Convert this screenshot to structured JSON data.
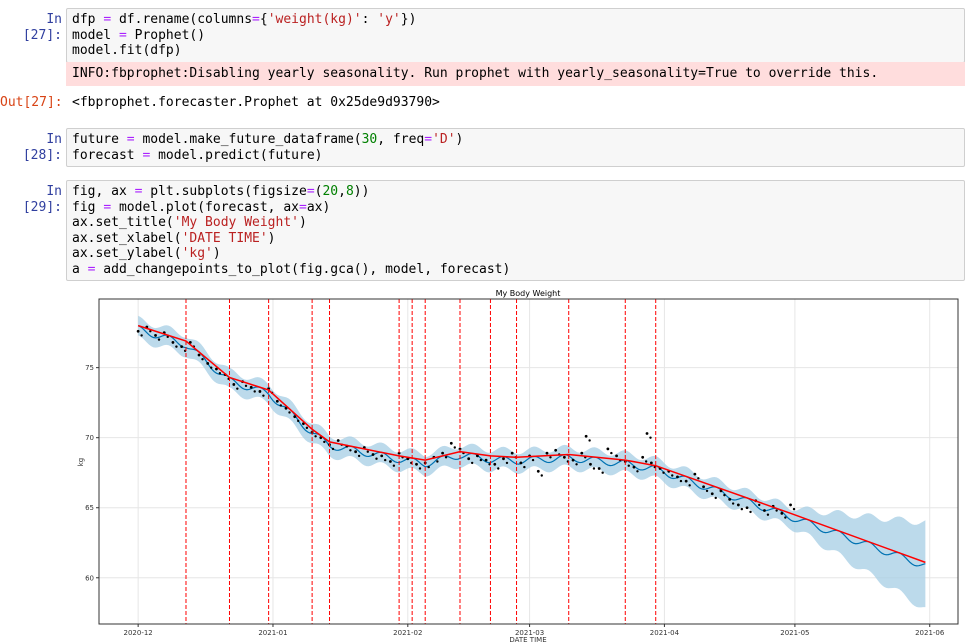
{
  "cells": [
    {
      "prompt": "In [27]:",
      "lines": [
        [
          [
            "dfp ",
            ""
          ],
          [
            "=",
            "op"
          ],
          [
            " df.rename(columns",
            ""
          ],
          [
            "=",
            "op"
          ],
          [
            "{",
            ""
          ],
          [
            "'weight(kg)'",
            "str"
          ],
          [
            ": ",
            ""
          ],
          [
            "'y'",
            "str"
          ],
          [
            "})",
            ""
          ]
        ],
        [
          [
            "model ",
            ""
          ],
          [
            "=",
            "op"
          ],
          [
            " Prophet()",
            ""
          ]
        ],
        [
          [
            "model.fit(dfp)",
            ""
          ]
        ]
      ]
    },
    {
      "prompt": "In [28]:",
      "lines": [
        [
          [
            "future ",
            ""
          ],
          [
            "=",
            "op"
          ],
          [
            " model.make_future_dataframe(",
            ""
          ],
          [
            "30",
            "num"
          ],
          [
            ", freq",
            ""
          ],
          [
            "=",
            "op"
          ],
          [
            "'D'",
            "str"
          ],
          [
            ")",
            ""
          ]
        ],
        [
          [
            "forecast ",
            ""
          ],
          [
            "=",
            "op"
          ],
          [
            " model.predict(future)",
            ""
          ]
        ]
      ]
    },
    {
      "prompt": "In [29]:",
      "lines": [
        [
          [
            "fig, ax ",
            ""
          ],
          [
            "=",
            "op"
          ],
          [
            " plt.subplots(figsize",
            ""
          ],
          [
            "=",
            "op"
          ],
          [
            "(",
            ""
          ],
          [
            "20",
            "num"
          ],
          [
            ",",
            ""
          ],
          [
            "8",
            "num"
          ],
          [
            "))",
            ""
          ]
        ],
        [
          [
            "fig ",
            ""
          ],
          [
            "=",
            "op"
          ],
          [
            " model.plot(forecast, ax",
            ""
          ],
          [
            "=",
            "op"
          ],
          [
            "ax)",
            ""
          ]
        ],
        [
          [
            "ax.set_title(",
            ""
          ],
          [
            "'My Body Weight'",
            "str"
          ],
          [
            ")",
            ""
          ]
        ],
        [
          [
            "ax.set_xlabel(",
            ""
          ],
          [
            "'DATE TIME'",
            "str"
          ],
          [
            ")",
            ""
          ]
        ],
        [
          [
            "ax.set_ylabel(",
            ""
          ],
          [
            "'kg'",
            "str"
          ],
          [
            ")",
            ""
          ]
        ],
        [
          [
            "a ",
            ""
          ],
          [
            "=",
            "op"
          ],
          [
            " add_changepoints_to_plot(fig.gca(), model, forecast)",
            ""
          ]
        ]
      ]
    }
  ],
  "stderr_27": "INFO:fbprophet:Disabling yearly seasonality. Run prophet with yearly_seasonality=True to override this.",
  "out_27": {
    "prompt": "Out[27]:",
    "text": "<fbprophet.forecaster.Prophet at 0x25de9d93790>"
  },
  "chart_data": {
    "type": "line",
    "title": "My Body Weight",
    "xlabel": "DATE TIME",
    "ylabel": "kg",
    "x_unit": "days since 2020-12-01",
    "xlim": [
      -9,
      188.5
    ],
    "ylim": [
      56.7,
      79.9
    ],
    "xticks": [
      {
        "day": 0,
        "label": "2020-12"
      },
      {
        "day": 31,
        "label": "2021-01"
      },
      {
        "day": 62,
        "label": "2021-02"
      },
      {
        "day": 90,
        "label": "2021-03"
      },
      {
        "day": 121,
        "label": "2021-04"
      },
      {
        "day": 151,
        "label": "2021-05"
      },
      {
        "day": 182,
        "label": "2021-06"
      }
    ],
    "yticks": [
      60,
      65,
      70,
      75
    ],
    "grid": true,
    "colors": {
      "observed": "#000000",
      "forecast": "#0072b2",
      "band": "#a6cde4",
      "trend": "#ff0000",
      "changepoint": "#ff0000"
    },
    "trend": [
      [
        0,
        78.0
      ],
      [
        11,
        76.9
      ],
      [
        21,
        74.3
      ],
      [
        30,
        73.4
      ],
      [
        40,
        70.6
      ],
      [
        44,
        69.7
      ],
      [
        60,
        68.7
      ],
      [
        66,
        68.4
      ],
      [
        74,
        69.0
      ],
      [
        81,
        68.7
      ],
      [
        87,
        68.6
      ],
      [
        99,
        68.8
      ],
      [
        112,
        68.4
      ],
      [
        119,
        68.0
      ],
      [
        150,
        64.6
      ],
      [
        181,
        61.1
      ]
    ],
    "changepoints": [
      11,
      21,
      30,
      40,
      44,
      60,
      63,
      66,
      74,
      81,
      87,
      99,
      112,
      119
    ],
    "band": [
      [
        0,
        0.7
      ],
      [
        150,
        0.7
      ],
      [
        155,
        1.0
      ],
      [
        165,
        1.8
      ],
      [
        175,
        2.6
      ],
      [
        181,
        3.1
      ]
    ],
    "observed": [
      [
        0,
        77.6
      ],
      [
        2,
        77.9
      ],
      [
        4,
        77.3
      ],
      [
        6,
        77.5
      ],
      [
        8,
        76.8
      ],
      [
        10,
        76.5
      ],
      [
        12,
        76.8
      ],
      [
        14,
        75.9
      ],
      [
        16,
        75.3
      ],
      [
        18,
        74.9
      ],
      [
        20,
        74.5
      ],
      [
        22,
        73.8
      ],
      [
        24,
        74.0
      ],
      [
        26,
        73.6
      ],
      [
        28,
        73.3
      ],
      [
        30,
        73.5
      ],
      [
        32,
        72.6
      ],
      [
        34,
        72.1
      ],
      [
        36,
        71.5
      ],
      [
        38,
        71.0
      ],
      [
        40,
        70.4
      ],
      [
        42,
        70.0
      ],
      [
        44,
        69.5
      ],
      [
        46,
        69.8
      ],
      [
        48,
        69.4
      ],
      [
        50,
        69.0
      ],
      [
        52,
        69.3
      ],
      [
        54,
        68.8
      ],
      [
        56,
        68.7
      ],
      [
        58,
        68.3
      ],
      [
        60,
        68.9
      ],
      [
        62,
        68.5
      ],
      [
        64,
        68.1
      ],
      [
        66,
        68.2
      ],
      [
        68,
        68.6
      ],
      [
        70,
        68.9
      ],
      [
        72,
        69.6
      ],
      [
        74,
        69.2
      ],
      [
        76,
        68.5
      ],
      [
        78,
        68.7
      ],
      [
        80,
        68.4
      ],
      [
        82,
        68.1
      ],
      [
        84,
        68.5
      ],
      [
        86,
        68.9
      ],
      [
        88,
        68.2
      ],
      [
        90,
        68.7
      ],
      [
        92,
        67.6
      ],
      [
        94,
        68.9
      ],
      [
        96,
        69.1
      ],
      [
        98,
        68.6
      ],
      [
        100,
        68.4
      ],
      [
        102,
        68.9
      ],
      [
        103,
        70.1
      ],
      [
        104,
        68.1
      ],
      [
        106,
        67.8
      ],
      [
        108,
        69.2
      ],
      [
        110,
        68.7
      ],
      [
        112,
        68.3
      ],
      [
        114,
        67.9
      ],
      [
        116,
        68.6
      ],
      [
        117,
        70.3
      ],
      [
        118,
        68.2
      ],
      [
        120,
        67.8
      ],
      [
        122,
        67.6
      ],
      [
        124,
        67.2
      ],
      [
        126,
        66.9
      ],
      [
        128,
        67.4
      ],
      [
        130,
        66.5
      ],
      [
        132,
        66.0
      ],
      [
        134,
        66.2
      ],
      [
        136,
        65.6
      ],
      [
        138,
        65.2
      ],
      [
        140,
        65.0
      ],
      [
        142,
        65.5
      ],
      [
        144,
        64.8
      ],
      [
        146,
        65.1
      ],
      [
        148,
        64.6
      ],
      [
        150,
        65.2
      ]
    ]
  }
}
